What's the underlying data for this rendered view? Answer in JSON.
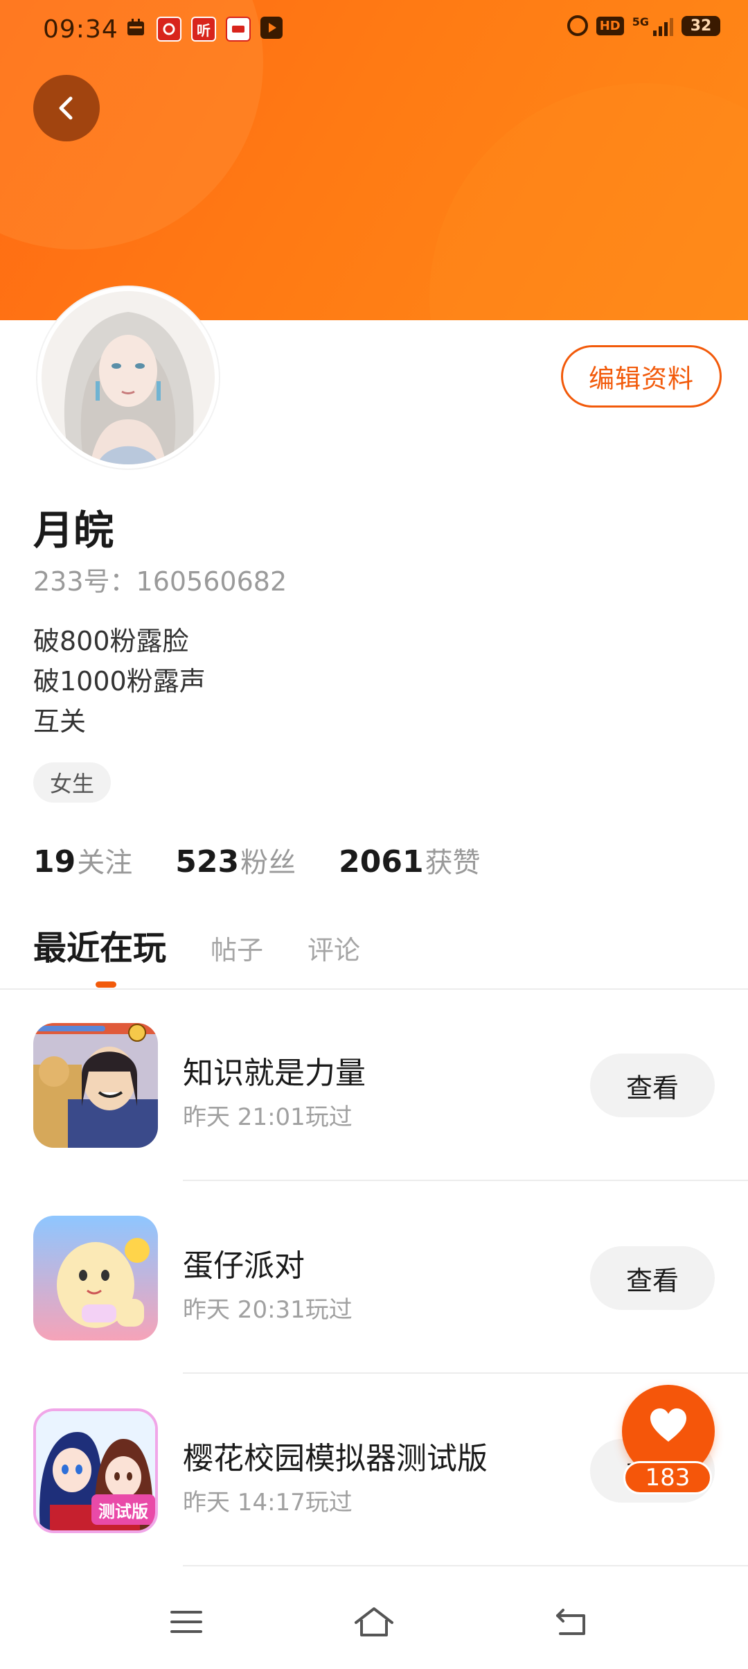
{
  "status_bar": {
    "time": "09:34",
    "notification_icons": [
      "calendar-icon",
      "app-icon-38",
      "ting-icon",
      "app-icon-red",
      "video-play-icon"
    ],
    "ting_label": "听",
    "right_icons": [
      "alarm-icon",
      "hd-icon",
      "5g-signal-icon",
      "battery-icon"
    ],
    "hd_label": "HD",
    "network_label": "5G",
    "battery": "32"
  },
  "header": {
    "accent_color": "#ff7a14",
    "back_icon": "chevron-left-icon"
  },
  "profile": {
    "edit_button_label": "编辑资料",
    "name": "月皖",
    "id_text": "233号：160560682",
    "bio_lines": [
      "破800粉露脸",
      "破1000粉露声",
      "互关"
    ],
    "gender_tag": "女生",
    "stats": [
      {
        "num": "19",
        "label": "关注"
      },
      {
        "num": "523",
        "label": "粉丝"
      },
      {
        "num": "2061",
        "label": "获赞"
      }
    ]
  },
  "tabs": [
    {
      "label": "最近在玩",
      "active": true
    },
    {
      "label": "帖子",
      "active": false
    },
    {
      "label": "评论",
      "active": false
    }
  ],
  "games": [
    {
      "title": "知识就是力量",
      "time": "昨天  21:01玩过",
      "button": "查看"
    },
    {
      "title": "蛋仔派对",
      "time": "昨天  20:31玩过",
      "button": "查看"
    },
    {
      "title": "樱花校园模拟器测试版",
      "time": "昨天  14:17玩过",
      "button": "查看",
      "badge": "测试版"
    }
  ],
  "like": {
    "icon": "heart-icon",
    "count": "183"
  },
  "bottom_nav": [
    "menu-icon",
    "home-icon",
    "back-icon"
  ]
}
